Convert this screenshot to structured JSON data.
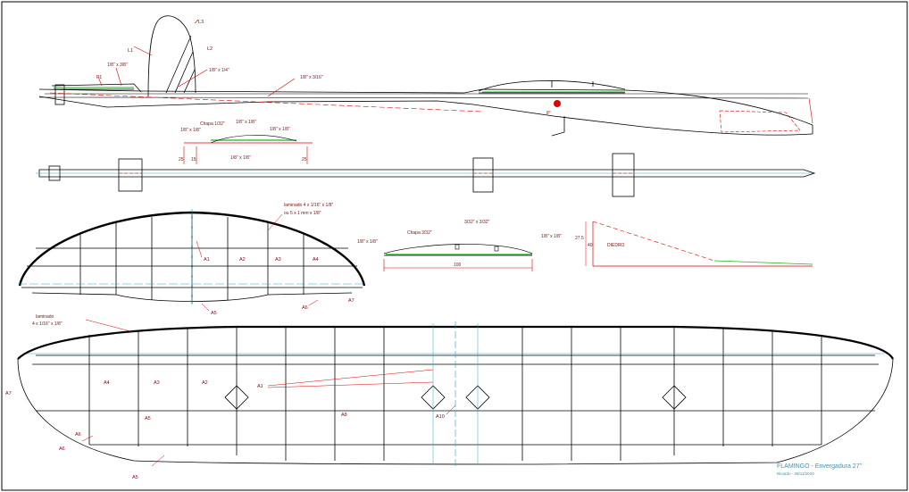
{
  "colors": {
    "outline": "#000000",
    "dim_line": "#e00000",
    "center_line": "#22a7c9",
    "balsa_sheet": "#20b020",
    "label": "#7a1010",
    "title": "#2a9bc8"
  },
  "fuselage_side": {
    "fin_labels": [
      "L3",
      "L1",
      "L2"
    ],
    "fin_wood": "1/8\" x 1/4\"",
    "stab_mount": "1/8\" x 3/8\"",
    "nose_wood": "3/32\" x 3/16\"",
    "nose_part": "P1",
    "fuselage_wood": "1/8\" x 3/16\"",
    "wing_angle": "8°"
  },
  "fuselage_top": {},
  "stab_section": {
    "sheet": "Chapa 1/32\"",
    "spar": "1/8\" x 1/8\"",
    "spar2": "1/8\" x 1/8\"",
    "le": "1/8\" x 1/8\"",
    "te": "1/8\" x 1/8\"",
    "dims": [
      "25",
      "15",
      "25"
    ]
  },
  "stabilizer": {
    "callout": "laminado 4 x 1/16\" x 1/8\"",
    "callout2": "ou 5 x 1 mm x 1/8\"",
    "ribs": [
      "A1",
      "A2",
      "A3",
      "A4",
      "A5",
      "A6",
      "A7"
    ]
  },
  "wing_section": {
    "sheet": "Chapa 3/32\"",
    "spar": "3/32\" x 3/32\"",
    "le": "1/8\" x 1/8\"",
    "te": "1/8\" x 1/8\"",
    "chord": "100"
  },
  "dihedral": {
    "label": "DIEDRO",
    "height": "40",
    "height2": "27.5"
  },
  "wing": {
    "callout": "laminado",
    "callout2": "4 x 1/16\" x 1/8\"",
    "ribs": [
      "A7",
      "A6",
      "A5",
      "A4",
      "A3",
      "A2",
      "A1",
      "A8",
      "A10",
      "A5",
      "A6"
    ]
  },
  "title_block": {
    "title": "FLAMINGO - Envergadura 27\"",
    "subtitle": "Ricardo - 28/11/2020"
  }
}
